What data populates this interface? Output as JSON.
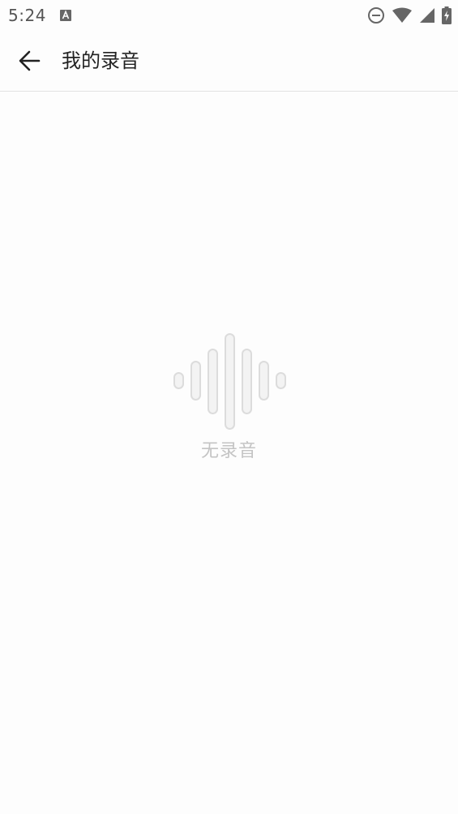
{
  "status_bar": {
    "time": "5:24",
    "icons": [
      "text-notification-icon",
      "do-not-disturb-icon",
      "wifi-icon",
      "cell-signal-icon",
      "battery-charging-icon"
    ]
  },
  "app_bar": {
    "back_icon": "arrow-left-icon",
    "title": "我的录音"
  },
  "empty_state": {
    "icon": "sound-wave-icon",
    "label": "无录音"
  },
  "colors": {
    "background": "#fdfdfd",
    "title_text": "#222222",
    "empty_text": "#c4c4c4",
    "divider": "#e2e2e2"
  }
}
